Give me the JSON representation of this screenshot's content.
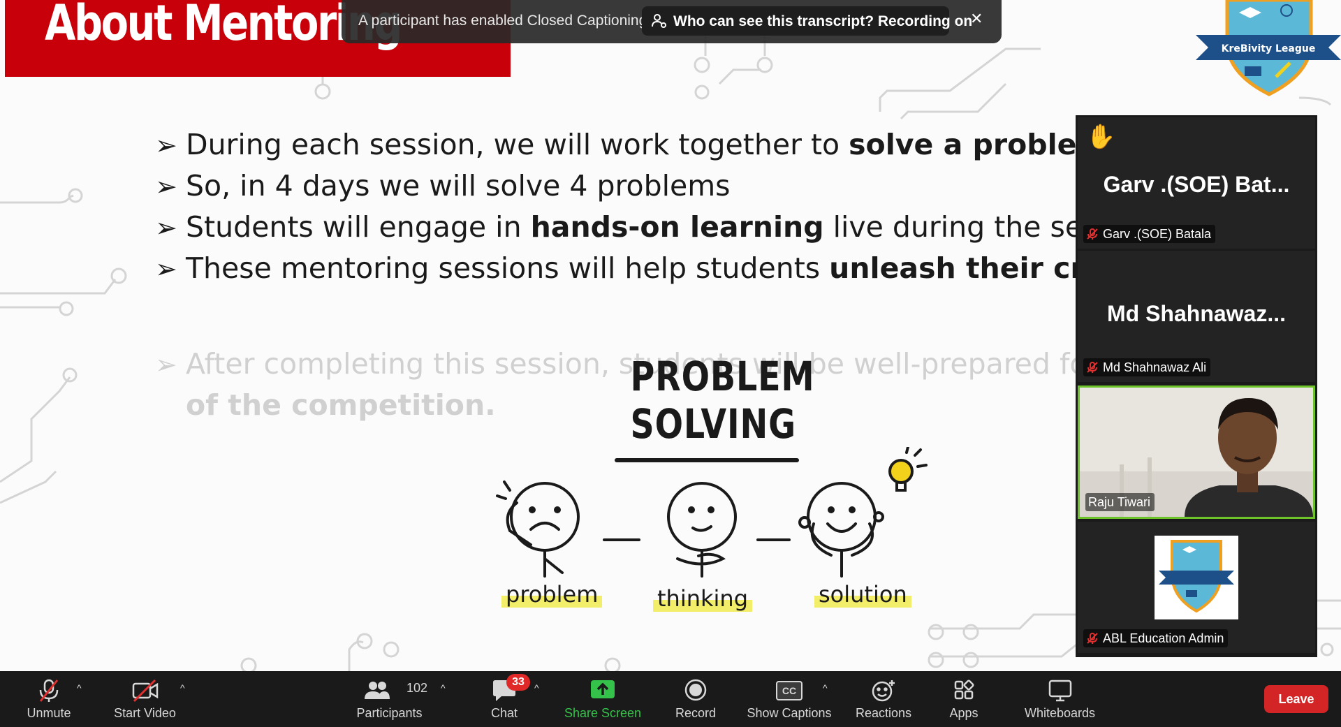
{
  "slide": {
    "title": "About Mentoring",
    "bullets": [
      {
        "parts": [
          {
            "t": "During each session, we will work together to ",
            "b": false
          },
          {
            "t": "solve a problem every",
            "b": true
          }
        ]
      },
      {
        "parts": [
          {
            "t": "So, in 4 days we will solve 4 problems",
            "b": false
          }
        ]
      },
      {
        "parts": [
          {
            "t": "Students will engage in ",
            "b": false
          },
          {
            "t": "hands-on learning",
            "b": true
          },
          {
            "t": " live during the sessions",
            "b": false
          }
        ]
      },
      {
        "parts": [
          {
            "t": "These mentoring sessions will help students ",
            "b": false
          },
          {
            "t": "unleash their creativity",
            "b": true
          }
        ]
      }
    ],
    "arrow_glyph": "➢",
    "faded_line1": "After completing this session, students will be well-prepared for the",
    "faded_line2": "of the competition.",
    "illustration": {
      "title_line1": "PROBLEM",
      "title_line2": "SOLVING",
      "labels": [
        "problem",
        "thinking",
        "solution"
      ]
    },
    "logo_text": "KreBivity League"
  },
  "notification": {
    "message": "A participant has enabled Closed Captioning",
    "pill_text": "Who can see this transcript? Recording on",
    "close_glyph": "✕"
  },
  "participants": {
    "tiles": [
      {
        "display_name": "Garv .(SOE) Bat...",
        "footer_name": "Garv .(SOE) Batala",
        "hand_raised": "✋",
        "muted": true
      },
      {
        "display_name": "Md Shahnawaz...",
        "footer_name": "Md Shahnawaz Ali",
        "muted": true
      },
      {
        "footer_name": "Raju Tiwari",
        "video_on": true
      },
      {
        "footer_name": "ABL Education Admin",
        "muted": true,
        "logo": true
      }
    ]
  },
  "toolbar": {
    "unmute": "Unmute",
    "start_video": "Start Video",
    "participants": "Participants",
    "participants_count": "102",
    "chat": "Chat",
    "chat_badge": "33",
    "share_screen": "Share Screen",
    "record": "Record",
    "show_captions": "Show Captions",
    "cc_glyph": "CC",
    "reactions": "Reactions",
    "apps": "Apps",
    "whiteboards": "Whiteboards",
    "leave": "Leave",
    "caret": "^"
  },
  "colors": {
    "banner": "#c8000a",
    "leave": "#d32525",
    "share_green": "#35c24a",
    "active_speaker": "#6ec32a",
    "badge": "#e02828"
  }
}
